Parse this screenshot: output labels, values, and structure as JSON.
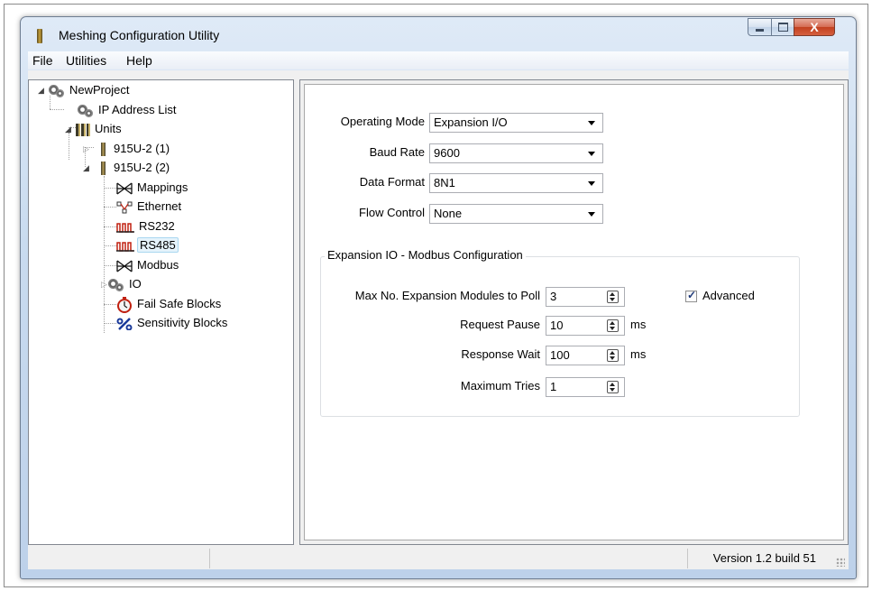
{
  "window": {
    "title": "Meshing Configuration Utility",
    "buttons": {
      "minimize": "minimize",
      "maximize": "maximize",
      "close": "X"
    }
  },
  "menu": {
    "items": [
      "File",
      "Utilities",
      "Help"
    ]
  },
  "tree": {
    "project": "NewProject",
    "ip_list": "IP Address List",
    "units": "Units",
    "unit1": "915U-2 (1)",
    "unit2": "915U-2 (2)",
    "children": [
      "Mappings",
      "Ethernet",
      "RS232",
      "RS485",
      "Modbus",
      "IO",
      "Fail Safe Blocks",
      "Sensitivity Blocks"
    ],
    "selected": "RS485"
  },
  "form": {
    "operating_mode": {
      "label": "Operating Mode",
      "value": "Expansion I/O"
    },
    "baud_rate": {
      "label": "Baud Rate",
      "value": "9600"
    },
    "data_format": {
      "label": "Data Format",
      "value": "8N1"
    },
    "flow_control": {
      "label": "Flow Control",
      "value": "None"
    },
    "group": {
      "title": "Expansion IO - Modbus Configuration",
      "max_modules": {
        "label": "Max No. Expansion Modules to Poll",
        "value": "3"
      },
      "request_pause": {
        "label": "Request Pause",
        "value": "10",
        "unit": "ms"
      },
      "response_wait": {
        "label": "Response Wait",
        "value": "100",
        "unit": "ms"
      },
      "max_tries": {
        "label": "Maximum Tries",
        "value": "1"
      },
      "advanced": {
        "label": "Advanced",
        "checked": true
      }
    }
  },
  "status": {
    "version": "Version 1.2 build 51"
  }
}
